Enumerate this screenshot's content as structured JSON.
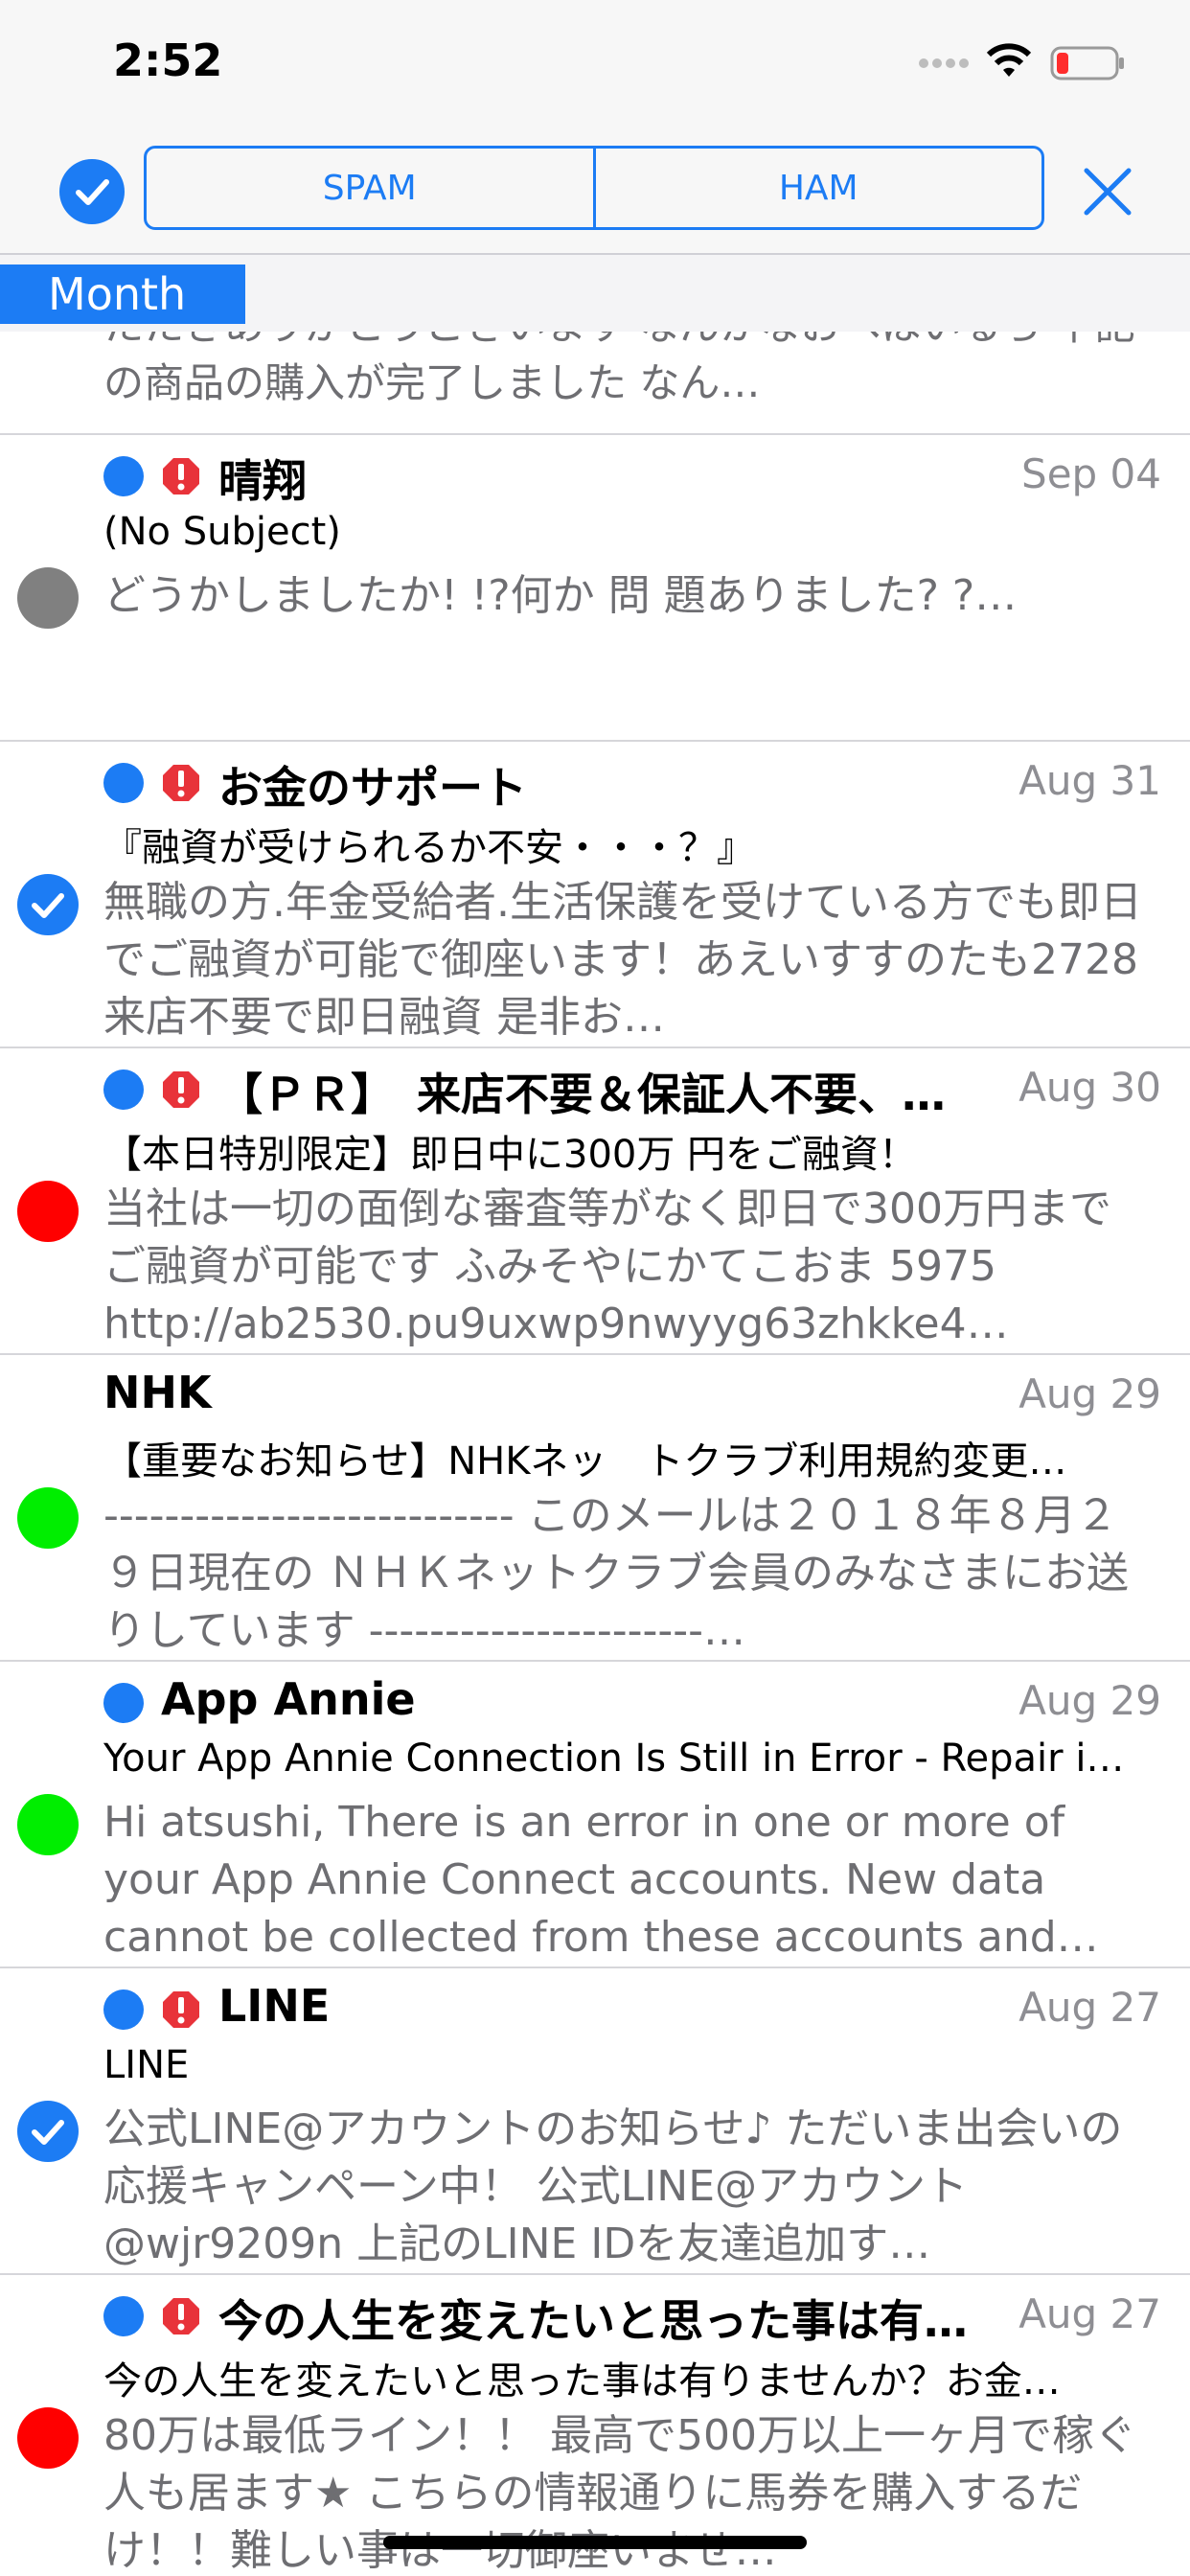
{
  "status_bar": {
    "time": "2:52"
  },
  "toolbar": {
    "spam_label": "SPAM",
    "ham_label": "HAM"
  },
  "section": {
    "label": "Month"
  },
  "partial_preview": "たたきありがとうございます なんかなおへはいるら 下記の商品の購入が完了しました なん…",
  "messages": [
    {
      "sender": "晴翔",
      "date": "Sep 04",
      "subject": "(No Subject)",
      "preview": "どうかしましたか! !?何か 問 題ありました? ?…",
      "bullet": "gray",
      "unread": true,
      "flag": true
    },
    {
      "sender": "お金のサポート",
      "date": "Aug 31",
      "subject": "『融資が受けられるか不安・・・？』",
      "preview": "無職の方.年金受給者.生活保護を受けている方でも即日でご融資が可能で御座います！あえいすすのたも2728 来店不要で即日融資 是非お…",
      "bullet": "check",
      "unread": true,
      "flag": true
    },
    {
      "sender": "【ＰＲ】　来店不要＆保証人不要、…",
      "date": "Aug 30",
      "subject": "【本日特別限定】即日中に300万 円をご融資！",
      "preview": "当社は一切の面倒な審査等がなく即日で300万円までご融資が可能です ふみそやにかてこおま 5975 http://ab2530.pu9uxwp9nwyyg63zhkke4…",
      "bullet": "red",
      "unread": true,
      "flag": true
    },
    {
      "sender": "NHK",
      "date": "Aug 29",
      "subject": "【重要なお知らせ】NHKネッ　トクラブ利用規約変更…",
      "preview": "--------------------------- このメールは２０１８年８月２９日現在の ＮＨＫネットクラブ会員のみなさまにお送りしています ----------------------…",
      "bullet": "green",
      "unread": false,
      "flag": false
    },
    {
      "sender": "App Annie",
      "date": "Aug 29",
      "subject": "Your App Annie Connection Is Still in Error - Repair i…",
      "preview": "Hi atsushi, There is an error in one or more of your App Annie Connect accounts. New data cannot be collected from these accounts and…",
      "bullet": "green",
      "unread": true,
      "flag": false
    },
    {
      "sender": "LINE",
      "date": "Aug 27",
      "subject": "LINE",
      "preview": "公式LINE@アカウントのお知らせ♪ ただいま出会いの応援キャンペーン中！ 公式LINE@アカウント @wjr9209n 上記のLINE IDを友達追加す…",
      "bullet": "check",
      "unread": true,
      "flag": true
    },
    {
      "sender": "今の人生を変えたいと思った事は有…",
      "date": "Aug 27",
      "subject": "今の人生を変えたいと思った事は有りませんか？お金…",
      "preview": "80万は最低ライン！！ 最高で500万以上一ヶ月で稼ぐ人も居ます★ こちらの情報通りに馬券を購入するだけ！！難しい事は一切御座いませ…",
      "bullet": "red",
      "unread": true,
      "flag": true
    }
  ],
  "colors": {
    "accent": "#1c7cf4",
    "red": "#ff0000",
    "green": "#00ee00",
    "gray": "#808080"
  }
}
